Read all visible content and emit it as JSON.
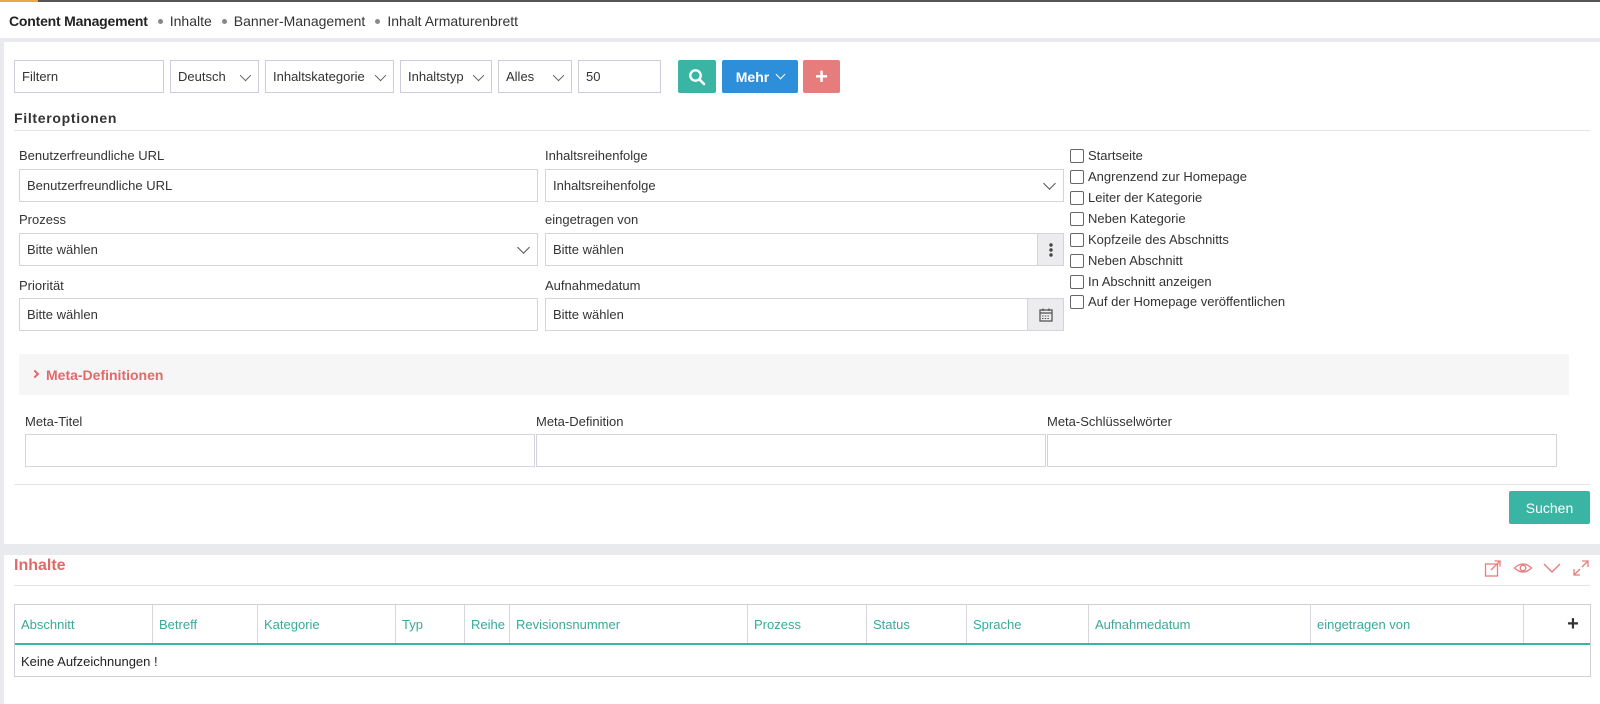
{
  "breadcrumb": {
    "root": "Content Management",
    "items": [
      "Inhalte",
      "Banner-Management",
      "Inhalt Armaturenbrett"
    ]
  },
  "toolbar": {
    "filter_placeholder": "Filtern",
    "language": "Deutsch",
    "category": "Inhaltskategorie",
    "type": "Inhaltstyp",
    "scope": "Alles",
    "page_size": "50",
    "more_label": "Mehr",
    "add_label": "+"
  },
  "filter_options": {
    "title": "Filteroptionen",
    "friendly_url": {
      "label": "Benutzerfreundliche URL",
      "placeholder": "Benutzerfreundliche URL"
    },
    "content_order": {
      "label": "Inhaltsreihenfolge",
      "value": "Inhaltsreihenfolge"
    },
    "process": {
      "label": "Prozess",
      "value": "Bitte wählen"
    },
    "entered_by": {
      "label": "eingetragen von",
      "value": "Bitte wählen"
    },
    "priority": {
      "label": "Priorität",
      "value": "Bitte wählen"
    },
    "record_date": {
      "label": "Aufnahmedatum",
      "value": "Bitte wählen"
    },
    "checkboxes": [
      "Startseite",
      "Angrenzend zur Homepage",
      "Leiter der Kategorie",
      "Neben Kategorie",
      "Kopfzeile des Abschnitts",
      "Neben Abschnitt",
      "In Abschnitt anzeigen",
      "Auf der Homepage veröffentlichen"
    ]
  },
  "meta": {
    "section_title": "Meta-Definitionen",
    "title_label": "Meta-Titel",
    "definition_label": "Meta-Definition",
    "keywords_label": "Meta-Schlüsselwörter"
  },
  "search_button": "Suchen",
  "contents": {
    "title": "Inhalte",
    "columns": [
      "Abschnitt",
      "Betreff",
      "Kategorie",
      "Typ",
      "Reihe",
      "Revisionsnummer",
      "Prozess",
      "Status",
      "Sprache",
      "Aufnahmedatum",
      "eingetragen von"
    ],
    "add_column": "+",
    "empty_text": "Keine Aufzeichnungen !"
  },
  "colors": {
    "teal": "#3bb5a3",
    "blue": "#2d8fd9",
    "red": "#e77c7c",
    "title_red": "#e06a6a"
  },
  "icons": [
    "search-icon",
    "add-icon",
    "chevron-down-icon",
    "more-vertical-icon",
    "calendar-icon",
    "export-icon",
    "eye-icon",
    "collapse-icon",
    "expand-icon"
  ]
}
